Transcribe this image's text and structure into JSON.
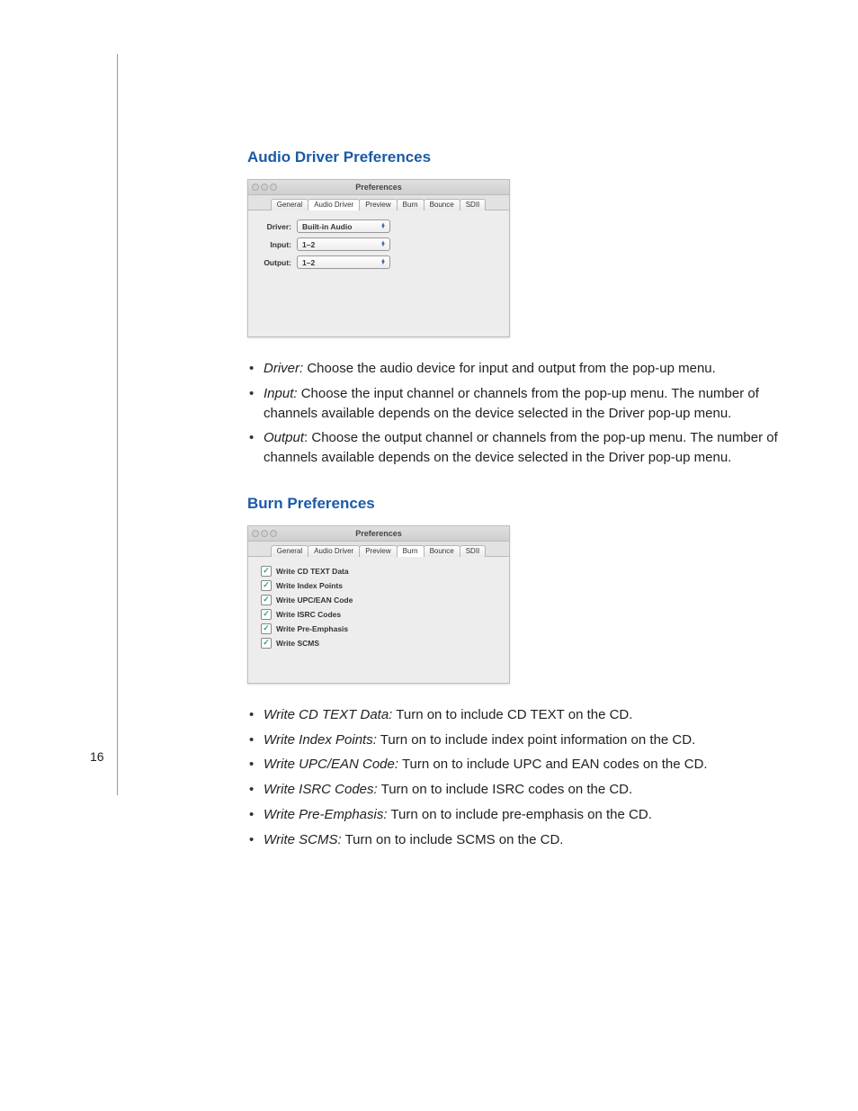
{
  "page_number": "16",
  "sections": {
    "audio": {
      "heading": "Audio Driver Preferences",
      "window_title": "Preferences",
      "tabs": [
        "General",
        "Audio Driver",
        "Preview",
        "Burn",
        "Bounce",
        "SDII"
      ],
      "active_tab_index": 1,
      "rows": {
        "driver": {
          "label": "Driver:",
          "value": "Built-in Audio"
        },
        "input": {
          "label": "Input:",
          "value": "1–2"
        },
        "output": {
          "label": "Output:",
          "value": "1–2"
        }
      },
      "defs": [
        {
          "term": "Driver:",
          "text": "  Choose the audio device for input and output from the pop-up menu."
        },
        {
          "term": "Input:",
          "text": "  Choose the input channel or channels from the pop-up menu. The number of channels available depends on the device selected in the Driver pop-up menu."
        },
        {
          "term": "Output",
          "text": ":  Choose the output channel or channels from the pop-up menu. The number of channels available depends on the device selected in the Driver pop-up menu."
        }
      ]
    },
    "burn": {
      "heading": "Burn Preferences",
      "window_title": "Preferences",
      "tabs": [
        "General",
        "Audio Driver",
        "Preview",
        "Burn",
        "Bounce",
        "SDII"
      ],
      "active_tab_index": 3,
      "checkboxes": [
        "Write CD TEXT Data",
        "Write Index Points",
        "Write UPC/EAN Code",
        "Write ISRC Codes",
        "Write Pre-Emphasis",
        "Write SCMS"
      ],
      "defs": [
        {
          "term": "Write CD TEXT Data:",
          "text": "  Turn on to include CD TEXT on the CD."
        },
        {
          "term": "Write Index Points:",
          "text": "  Turn on to include index point information on the CD."
        },
        {
          "term": "Write UPC/EAN Code:",
          "text": "  Turn on to include UPC and EAN codes on the CD."
        },
        {
          "term": "Write ISRC Codes:",
          "text": "  Turn on to include ISRC codes on the CD."
        },
        {
          "term": "Write Pre-Emphasis:",
          "text": "  Turn on to include pre-emphasis on the CD."
        },
        {
          "term": "Write SCMS:",
          "text": "  Turn on to include SCMS on the CD."
        }
      ]
    }
  }
}
